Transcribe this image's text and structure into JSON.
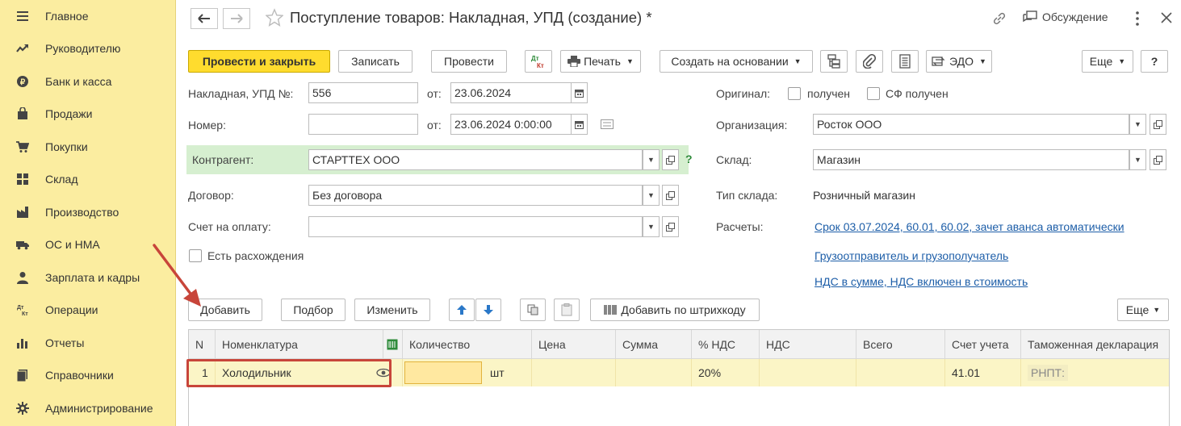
{
  "sidebar": {
    "items": [
      {
        "label": "Главное",
        "icon": "menu-lines-icon"
      },
      {
        "label": "Руководителю",
        "icon": "trend-chart-icon"
      },
      {
        "label": "Банк и касса",
        "icon": "coin-icon"
      },
      {
        "label": "Продажи",
        "icon": "shopping-bag-icon"
      },
      {
        "label": "Покупки",
        "icon": "shopping-cart-icon"
      },
      {
        "label": "Склад",
        "icon": "warehouse-grid-icon"
      },
      {
        "label": "Производство",
        "icon": "factory-icon"
      },
      {
        "label": "ОС и НМА",
        "icon": "truck-icon"
      },
      {
        "label": "Зарплата и кадры",
        "icon": "person-icon"
      },
      {
        "label": "Операции",
        "icon": "dt-kt-icon"
      },
      {
        "label": "Отчеты",
        "icon": "bar-chart-icon"
      },
      {
        "label": "Справочники",
        "icon": "books-icon"
      },
      {
        "label": "Администрирование",
        "icon": "gear-icon"
      }
    ],
    "dt_glyph": "Дт",
    "kt_glyph": "Кт"
  },
  "header": {
    "title": "Поступление товаров: Накладная, УПД (создание) *",
    "discussion_label": "Обсуждение"
  },
  "toolbar": {
    "post_close_label": "Провести и закрыть",
    "save_label": "Записать",
    "post_label": "Провести",
    "dt_glyph": "Дт",
    "kt_glyph": "Кт",
    "print_label": "Печать",
    "create_based_label": "Создать на основании",
    "edo_label": "ЭДО",
    "more_label": "Еще",
    "help_label": "?"
  },
  "form": {
    "invoice_label": "Накладная, УПД №:",
    "invoice_number": "556",
    "from_label": "от:",
    "invoice_date": "23.06.2024",
    "number_label": "Номер:",
    "number_value": "",
    "number_date": "23.06.2024  0:00:00",
    "counterparty_label": "Контрагент:",
    "counterparty_value": "СТАРТТЕХ ООО",
    "counterparty_help": "?",
    "contract_label": "Договор:",
    "contract_value": "Без договора",
    "payment_account_label": "Счет на оплату:",
    "payment_account_value": "",
    "discrepancies_label": "Есть расхождения",
    "original_label": "Оригинал:",
    "received_label": "получен",
    "sf_received_label": "СФ получен",
    "organization_label": "Организация:",
    "organization_value": "Росток ООО",
    "warehouse_label": "Склад:",
    "warehouse_value": "Магазин",
    "warehouse_type_label": "Тип склада:",
    "warehouse_type_value": "Розничный магазин",
    "settlements_label": "Расчеты:",
    "settlements_link": "Срок 03.07.2024, 60.01, 60.02, зачет аванса автоматически",
    "shipper_link": "Грузоотправитель и грузополучатель",
    "vat_link": "НДС в сумме, НДС включен в стоимость"
  },
  "table_toolbar": {
    "add_label": "Добавить",
    "select_label": "Подбор",
    "edit_label": "Изменить",
    "barcode_label": "Добавить по штрихкоду",
    "more_label": "Еще"
  },
  "table": {
    "columns": [
      "N",
      "Номенклатура",
      "Количество",
      "Цена",
      "Сумма",
      "% НДС",
      "НДС",
      "Всего",
      "Счет учета",
      "Таможенная декларация"
    ],
    "rows": [
      {
        "n": "1",
        "item": "Холодильник",
        "quantity": "",
        "unit": "шт",
        "price": "",
        "sum": "",
        "vat_rate": "20%",
        "vat": "",
        "total": "",
        "account": "41.01",
        "customs": "РНПТ:"
      }
    ]
  },
  "colors": {
    "sidebar_bg": "#fbeda0",
    "primary_button": "#ffdc2e",
    "counterparty_band": "#d6efd0",
    "row_highlight": "#fbf5c6",
    "link": "#1d5ea8",
    "annotation": "#c8453a"
  }
}
